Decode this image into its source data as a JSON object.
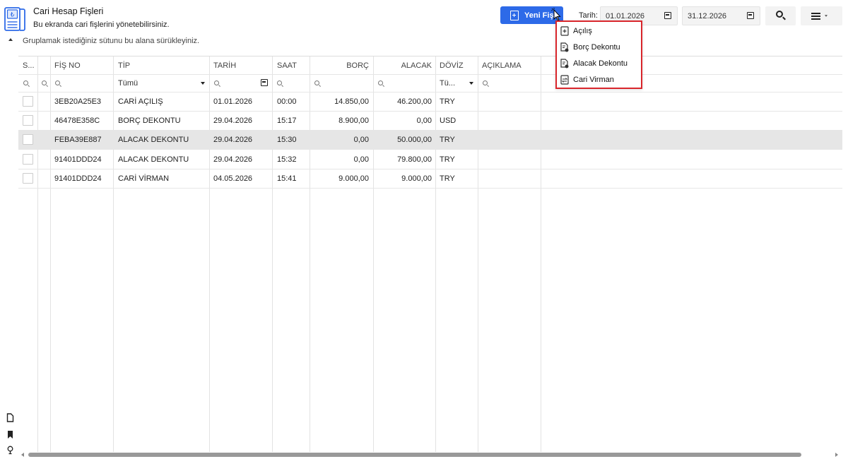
{
  "header": {
    "title": "Cari Hesap Fişleri",
    "subtitle": "Bu ekranda cari fişlerini yönetebilirsiniz.",
    "new_button_label": "Yeni Fiş",
    "date_label": "Tarih:",
    "date_start": "01.01.2026",
    "date_end": "31.12.2026"
  },
  "new_menu": {
    "items": [
      {
        "label": "Açılış",
        "icon": "plus-document-icon"
      },
      {
        "label": "Borç Dekontu",
        "icon": "document-gear-icon"
      },
      {
        "label": "Alacak Dekontu",
        "icon": "document-gear-icon"
      },
      {
        "label": "Cari Virman",
        "icon": "transfer-document-icon"
      }
    ]
  },
  "group_hint": "Gruplamak istediğiniz sütunu bu alana sürükleyiniz.",
  "grid": {
    "columns": [
      "S...",
      "",
      "FİŞ NO",
      "TİP",
      "TARİH",
      "SAAT",
      "BORÇ",
      "ALACAK",
      "DÖVİZ",
      "AÇIKLAMA"
    ],
    "filters": {
      "tip": "Tümü",
      "doviz": "Tü..."
    },
    "rows": [
      {
        "fis_no": "3EB20A25E3",
        "tip": "CARİ AÇILIŞ",
        "tarih": "01.01.2026",
        "saat": "00:00",
        "borc": "14.850,00",
        "alacak": "46.200,00",
        "doviz": "TRY",
        "aciklama": ""
      },
      {
        "fis_no": "46478E358C",
        "tip": "BORÇ DEKONTU",
        "tarih": "29.04.2026",
        "saat": "15:17",
        "borc": "8.900,00",
        "alacak": "0,00",
        "doviz": "USD",
        "aciklama": ""
      },
      {
        "fis_no": "FEBA39E887",
        "tip": "ALACAK DEKONTU",
        "tarih": "29.04.2026",
        "saat": "15:30",
        "borc": "0,00",
        "alacak": "50.000,00",
        "doviz": "TRY",
        "aciklama": ""
      },
      {
        "fis_no": "91401DDD24",
        "tip": "ALACAK DEKONTU",
        "tarih": "29.04.2026",
        "saat": "15:32",
        "borc": "0,00",
        "alacak": "79.800,00",
        "doviz": "TRY",
        "aciklama": ""
      },
      {
        "fis_no": "91401DDD24",
        "tip": "CARİ VİRMAN",
        "tarih": "04.05.2026",
        "saat": "15:41",
        "borc": "9.000,00",
        "alacak": "9.000,00",
        "doviz": "TRY",
        "aciklama": ""
      }
    ]
  },
  "colors": {
    "accent": "#2d6ae8",
    "menu_border": "#d9262c",
    "selected_row": "#e6e6e6"
  }
}
